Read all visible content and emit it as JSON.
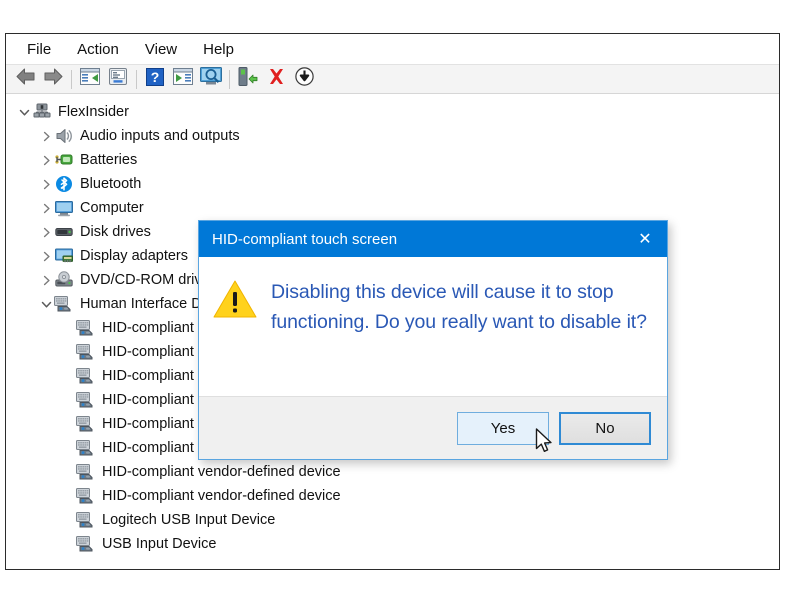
{
  "window": {
    "menubar": [
      {
        "label": "File",
        "name": "menu-file"
      },
      {
        "label": "Action",
        "name": "menu-action"
      },
      {
        "label": "View",
        "name": "menu-view"
      },
      {
        "label": "Help",
        "name": "menu-help"
      }
    ],
    "toolbar": [
      {
        "name": "back-icon",
        "title": "Back"
      },
      {
        "name": "forward-icon",
        "title": "Forward"
      },
      {
        "name": "separator",
        "title": ""
      },
      {
        "name": "show-hide-console-tree-icon",
        "title": "Show/Hide Console Tree"
      },
      {
        "name": "properties-icon",
        "title": "Properties"
      },
      {
        "name": "separator",
        "title": ""
      },
      {
        "name": "help-icon",
        "title": "Help"
      },
      {
        "name": "show-hide-action-pane-icon",
        "title": "Show/Hide Action Pane"
      },
      {
        "name": "scan-for-hardware-changes-icon",
        "title": "Scan for hardware changes"
      },
      {
        "name": "separator",
        "title": ""
      },
      {
        "name": "update-driver-icon",
        "title": "Update driver"
      },
      {
        "name": "uninstall-device-icon",
        "title": "Uninstall device"
      },
      {
        "name": "disable-device-icon",
        "title": "Disable device"
      }
    ]
  },
  "tree": {
    "root": {
      "label": "FlexInsider",
      "icon": "computer-root-icon",
      "expanded": true,
      "depth": 0
    },
    "items": [
      {
        "label": "Audio inputs and outputs",
        "icon": "speaker-icon",
        "twisty": "collapsed",
        "depth": 1
      },
      {
        "label": "Batteries",
        "icon": "battery-icon",
        "twisty": "collapsed",
        "depth": 1
      },
      {
        "label": "Bluetooth",
        "icon": "bluetooth-icon",
        "twisty": "collapsed",
        "depth": 1
      },
      {
        "label": "Computer",
        "icon": "monitor-icon",
        "twisty": "collapsed",
        "depth": 1
      },
      {
        "label": "Disk drives",
        "icon": "disk-drive-icon",
        "twisty": "collapsed",
        "depth": 1
      },
      {
        "label": "Display adapters",
        "icon": "display-adapter-icon",
        "twisty": "collapsed",
        "depth": 1
      },
      {
        "label": "DVD/CD-ROM drives",
        "icon": "dvd-drive-icon",
        "twisty": "collapsed",
        "depth": 1
      },
      {
        "label": "Human Interface Devices",
        "icon": "hid-icon",
        "twisty": "expanded",
        "depth": 1
      },
      {
        "label": "HID-compliant consumer control device",
        "icon": "hid-icon",
        "twisty": "none",
        "depth": 2
      },
      {
        "label": "HID-compliant consumer control device",
        "icon": "hid-icon",
        "twisty": "none",
        "depth": 2
      },
      {
        "label": "HID-compliant system controller",
        "icon": "hid-icon",
        "twisty": "none",
        "depth": 2
      },
      {
        "label": "HID-compliant touch screen",
        "icon": "hid-icon",
        "twisty": "none",
        "depth": 2
      },
      {
        "label": "HID-compliant vendor-defined device",
        "icon": "hid-icon",
        "twisty": "none",
        "depth": 2
      },
      {
        "label": "HID-compliant vendor-defined device",
        "icon": "hid-icon",
        "twisty": "none",
        "depth": 2
      },
      {
        "label": "HID-compliant vendor-defined device",
        "icon": "hid-icon",
        "twisty": "none",
        "depth": 2
      },
      {
        "label": "HID-compliant vendor-defined device",
        "icon": "hid-icon",
        "twisty": "none",
        "depth": 2
      },
      {
        "label": "Logitech USB Input Device",
        "icon": "hid-icon",
        "twisty": "none",
        "depth": 2
      },
      {
        "label": "USB Input Device",
        "icon": "hid-icon",
        "twisty": "none",
        "depth": 2
      }
    ]
  },
  "dialog": {
    "title": "HID-compliant touch screen",
    "close_label": "✕",
    "icon": "warning-icon",
    "message": "Disabling this device will cause it to stop functioning. Do you really want to disable it?",
    "buttons": [
      {
        "label": "Yes",
        "name": "yes-button",
        "state": "hover"
      },
      {
        "label": "No",
        "name": "no-button",
        "state": "focus"
      }
    ]
  },
  "colors": {
    "titlebar": "#0078d7",
    "message_text": "#2a58b5",
    "warning_fill": "#ffd21c",
    "accent_border": "#2f8ad4",
    "footer_bg": "#f0f0f0"
  }
}
